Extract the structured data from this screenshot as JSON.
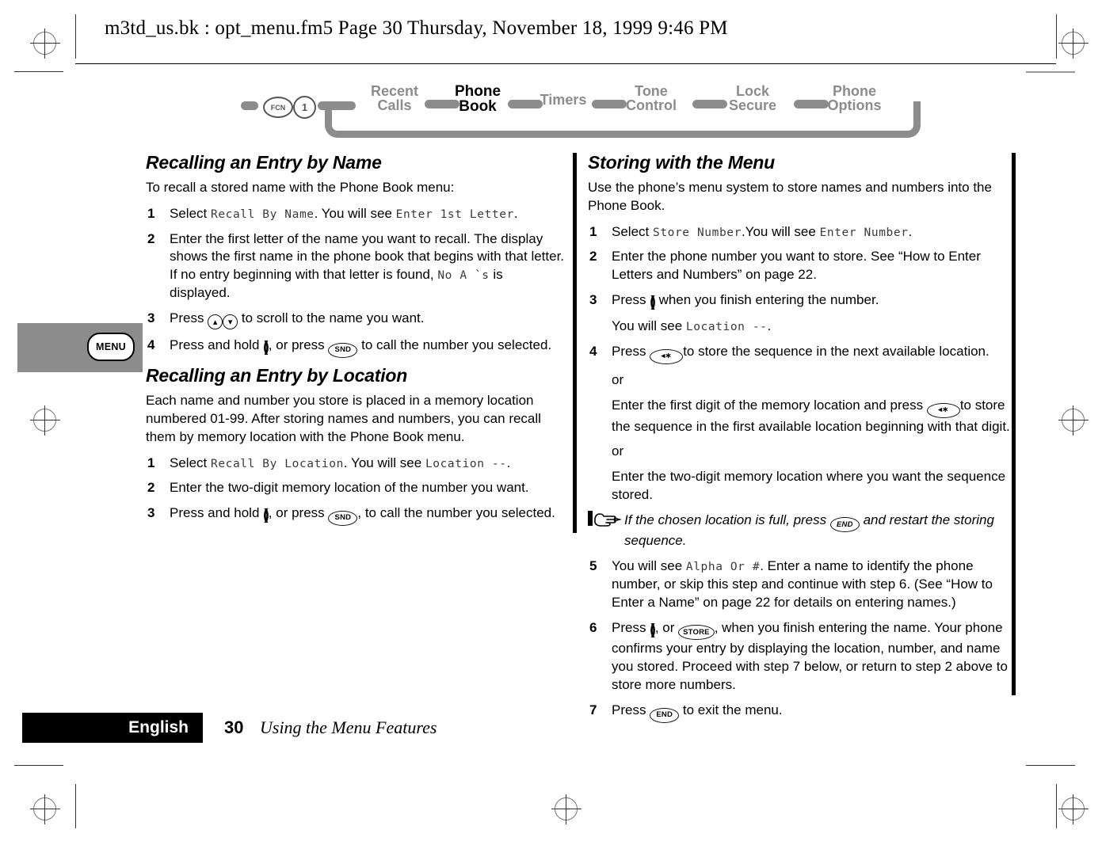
{
  "header": {
    "text": "m3td_us.bk : opt_menu.fm5  Page 30  Thursday, November 18, 1999  9:46 PM"
  },
  "margin_tab": {
    "key_label": "MENU"
  },
  "nav": {
    "fcn_key": "FCN",
    "digit_key": "1",
    "items": [
      {
        "line1": "Recent",
        "line2": "Calls",
        "active": false
      },
      {
        "line1": "Phone",
        "line2": "Book",
        "active": true
      },
      {
        "line1": "Timers",
        "line2": "",
        "active": false
      },
      {
        "line1": "Tone",
        "line2": "Control",
        "active": false
      },
      {
        "line1": "Lock",
        "line2": "Secure",
        "active": false
      },
      {
        "line1": "Phone",
        "line2": "Options",
        "active": false
      }
    ]
  },
  "left_column": {
    "section1": {
      "heading": "Recalling an Entry by Name",
      "intro": "To recall a stored name with the Phone Book menu:",
      "steps": [
        {
          "num": "1",
          "parts": [
            {
              "t": "text",
              "v": "Select "
            },
            {
              "t": "lcd",
              "v": "Recall By Name"
            },
            {
              "t": "text",
              "v": ". You will see "
            },
            {
              "t": "lcd",
              "v": "Enter 1st Letter"
            },
            {
              "t": "text",
              "v": "."
            }
          ]
        },
        {
          "num": "2",
          "parts": [
            {
              "t": "text",
              "v": "Enter the first letter of the name you want to recall. The display shows the first name in the phone book that begins with that letter. If no entry beginning with that letter is found, "
            },
            {
              "t": "lcd",
              "v": "No A `s"
            },
            {
              "t": "text",
              "v": " is displayed."
            }
          ]
        },
        {
          "num": "3",
          "parts": [
            {
              "t": "text",
              "v": "Press "
            },
            {
              "t": "key-up",
              "v": "up-arrow-key"
            },
            {
              "t": "key-down",
              "v": "down-arrow-key"
            },
            {
              "t": "text",
              "v": " to scroll to the name you want."
            }
          ]
        },
        {
          "num": "4",
          "parts": [
            {
              "t": "text",
              "v": "Press and hold "
            },
            {
              "t": "key-paren",
              "v": "()"
            },
            {
              "t": "text",
              "v": ", or press "
            },
            {
              "t": "key-oval",
              "v": "SND"
            },
            {
              "t": "text",
              "v": " to call the number you selected."
            }
          ]
        }
      ]
    },
    "section2": {
      "heading": "Recalling an Entry by Location",
      "intro": "Each name and number you store is placed in a memory location numbered 01-99. After storing names and numbers, you can recall them by memory location with the Phone Book menu.",
      "steps": [
        {
          "num": "1",
          "parts": [
            {
              "t": "text",
              "v": "Select "
            },
            {
              "t": "lcd",
              "v": "Recall By Location"
            },
            {
              "t": "text",
              "v": ". You will see "
            },
            {
              "t": "lcd",
              "v": "Location --"
            },
            {
              "t": "text",
              "v": "."
            }
          ]
        },
        {
          "num": "2",
          "parts": [
            {
              "t": "text",
              "v": "Enter the two-digit memory location of the number you want."
            }
          ]
        },
        {
          "num": "3",
          "parts": [
            {
              "t": "text",
              "v": "Press and hold "
            },
            {
              "t": "key-paren",
              "v": "()"
            },
            {
              "t": "text",
              "v": ", or press "
            },
            {
              "t": "key-oval",
              "v": "SND"
            },
            {
              "t": "text",
              "v": ", to call the number you selected."
            }
          ]
        }
      ]
    }
  },
  "right_column": {
    "section1": {
      "heading": "Storing with the Menu",
      "intro": "Use the phone’s menu system to store names and numbers into the Phone Book.",
      "steps": [
        {
          "num": "1",
          "parts": [
            {
              "t": "text",
              "v": "Select "
            },
            {
              "t": "lcd",
              "v": "Store Number"
            },
            {
              "t": "text",
              "v": ".You will see "
            },
            {
              "t": "lcd",
              "v": "Enter Number"
            },
            {
              "t": "text",
              "v": "."
            }
          ]
        },
        {
          "num": "2",
          "parts": [
            {
              "t": "text",
              "v": "Enter the phone number you want to store. See “How to Enter Letters and Numbers” on page 22."
            }
          ]
        },
        {
          "num": "3",
          "parts": [
            {
              "t": "text",
              "v": "Press "
            },
            {
              "t": "key-paren",
              "v": "()"
            },
            {
              "t": "text",
              "v": " when you finish entering the number."
            }
          ],
          "continuation": [
            {
              "t": "text",
              "v": "You will see "
            },
            {
              "t": "lcd",
              "v": "Location --"
            },
            {
              "t": "text",
              "v": "."
            }
          ]
        },
        {
          "num": "4",
          "parts": [
            {
              "t": "text",
              "v": "Press "
            },
            {
              "t": "key-star",
              "v": "star-key"
            },
            {
              "t": "text",
              "v": "to store the sequence in the next available location."
            }
          ]
        }
      ],
      "or_blocks": [
        {
          "or": "or",
          "parts": [
            {
              "t": "text",
              "v": "Enter the first digit of the memory location and press "
            },
            {
              "t": "key-star",
              "v": "star-key"
            },
            {
              "t": "text",
              "v": "to store the sequence in the first available location beginning with that digit."
            }
          ]
        },
        {
          "or": "or",
          "parts": [
            {
              "t": "text",
              "v": "Enter the two-digit memory location where you want the sequence stored."
            }
          ]
        }
      ],
      "note": [
        {
          "t": "text",
          "v": "If the chosen location is full, press "
        },
        {
          "t": "key-oval",
          "v": "END"
        },
        {
          "t": "text",
          "v": " and restart the storing sequence."
        }
      ],
      "steps_after": [
        {
          "num": "5",
          "parts": [
            {
              "t": "text",
              "v": "You will see "
            },
            {
              "t": "lcd",
              "v": "Alpha Or #"
            },
            {
              "t": "text",
              "v": ". Enter a name to identify the phone number, or skip this step and continue with step 6. (See “How to Enter a Name” on page 22 for details on entering names.)"
            }
          ]
        },
        {
          "num": "6",
          "parts": [
            {
              "t": "text",
              "v": "Press "
            },
            {
              "t": "key-paren",
              "v": "()"
            },
            {
              "t": "text",
              "v": ", or "
            },
            {
              "t": "key-oval",
              "v": "STORE"
            },
            {
              "t": "text",
              "v": ", when you finish entering the name. Your phone confirms your entry by displaying the location, number, and name you stored. Proceed with step 7 below, or return to step 2 above to store more numbers."
            }
          ]
        },
        {
          "num": "7",
          "parts": [
            {
              "t": "text",
              "v": "Press "
            },
            {
              "t": "key-oval",
              "v": "END"
            },
            {
              "t": "text",
              "v": " to exit the menu."
            }
          ]
        }
      ]
    }
  },
  "footer": {
    "language": "English",
    "page_number": "30",
    "title": "Using the Menu Features"
  }
}
